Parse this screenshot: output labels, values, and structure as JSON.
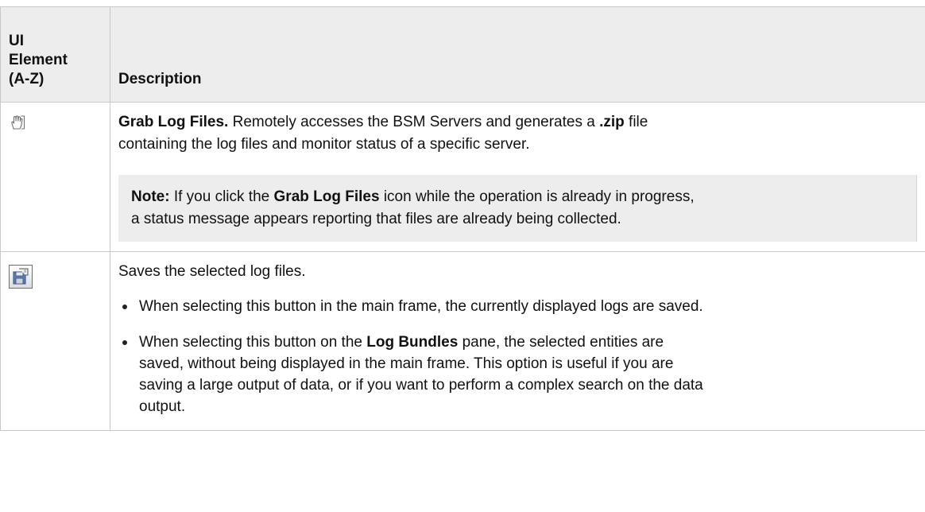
{
  "table": {
    "header": {
      "col1": [
        "UI",
        "Element",
        "(A-Z)"
      ],
      "col2": "Description"
    },
    "rows": [
      {
        "icon": "grab-log-files-icon",
        "title": "Grab Log Files.",
        "text_a": " Remotely accesses the BSM Servers and generates a ",
        "ext": ".zip",
        "text_b": " file",
        "line2": "containing the log files and monitor status of a specific server.",
        "note": {
          "label": "Note:",
          "text_a": " If you click the ",
          "bold_ref": "Grab Log Files",
          "text_b": " icon while the operation is already in progress,",
          "line2": "a status message appears reporting that files are already being collected."
        }
      },
      {
        "icon": "save-log-files-icon",
        "text": "Saves the selected log files.",
        "bullets": [
          {
            "lines": [
              "When selecting this button in the main frame, the currently displayed logs are saved."
            ]
          },
          {
            "text_a": "When selecting this button on the ",
            "bold_ref": "Log Bundles",
            "text_b": " pane, the selected entities are",
            "lines": [
              "saved, without being displayed in the main frame. This option is useful if you are",
              "saving a large output of data, or if you want to perform a complex search on the data",
              "output."
            ]
          }
        ]
      }
    ]
  }
}
